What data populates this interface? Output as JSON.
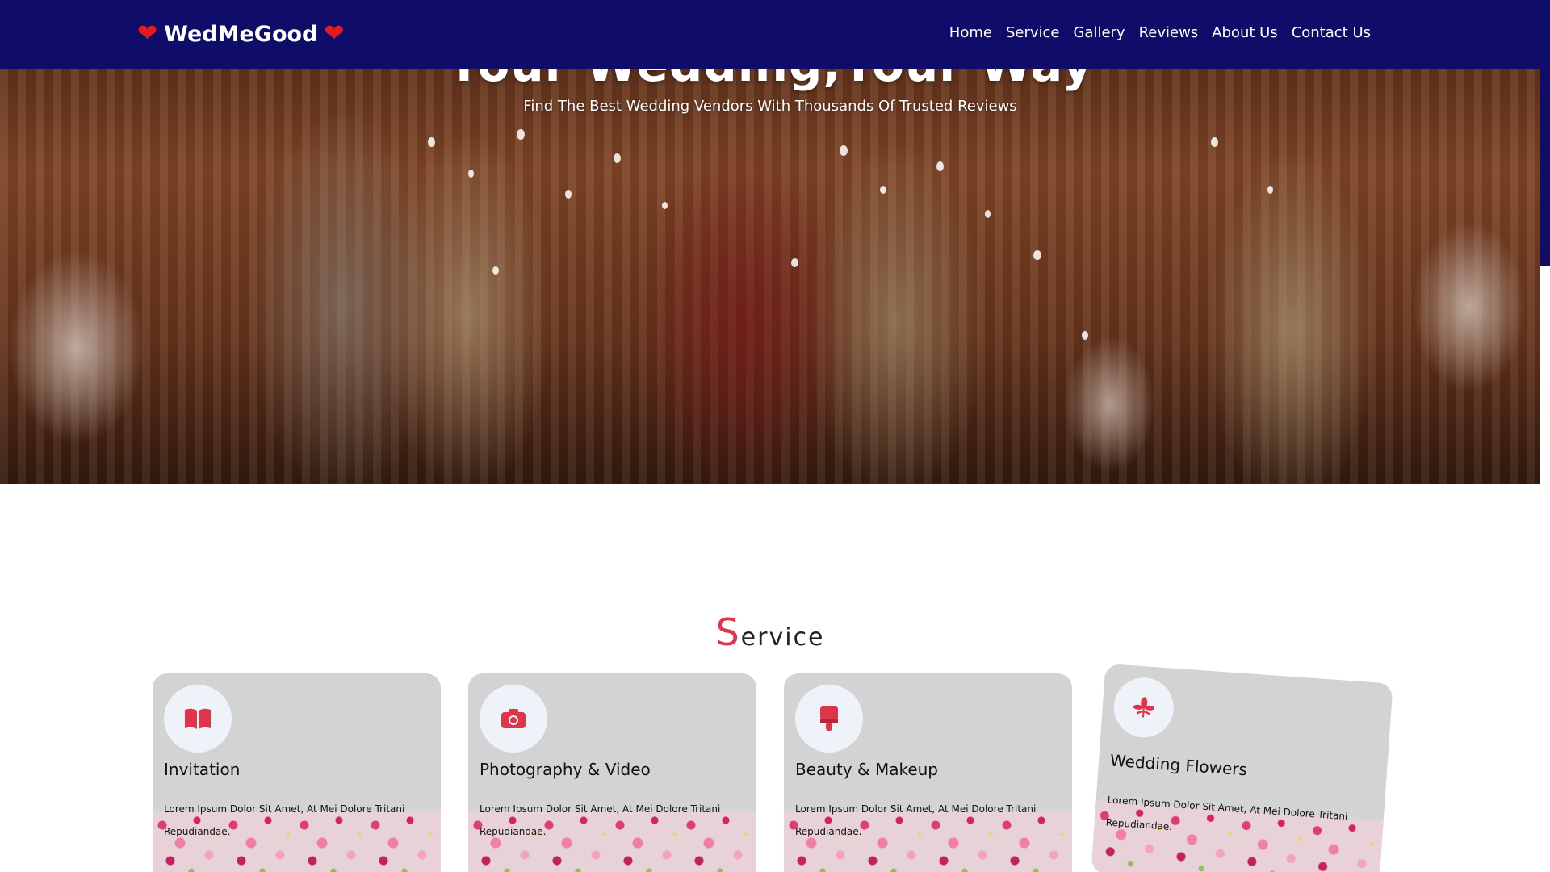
{
  "navbar": {
    "logo_text": "WedMeGood",
    "logo_heart_icon": "heart-icon",
    "links": [
      "Home",
      "Service",
      "Gallery",
      "Reviews",
      "About Us",
      "Contact Us"
    ],
    "background_color": "#100c6a"
  },
  "hero": {
    "title": "Your Wedding,Your Way",
    "subtitle": "Find The Best Wedding Vendors With Thousands Of Trusted Reviews"
  },
  "services": {
    "title_initial": "S",
    "title_rest": "ervice",
    "accent_color": "#e0344a",
    "cards": [
      {
        "icon": "book-icon",
        "title": "Invitation",
        "text": "Lorem Ipsum Dolor Sit Amet, At Mei Dolore Tritani Repudiandae."
      },
      {
        "icon": "camera-icon",
        "title": "Photography & Video",
        "text": "Lorem Ipsum Dolor Sit Amet, At Mei Dolore Tritani Repudiandae."
      },
      {
        "icon": "makeup-brush-icon",
        "title": "Beauty & Makeup",
        "text": "Lorem Ipsum Dolor Sit Amet, At Mei Dolore Tritani Repudiandae."
      },
      {
        "icon": "flower-icon",
        "title": "Wedding Flowers",
        "text": "Lorem Ipsum Dolor Sit Amet, At Mei Dolore Tritani Repudiandae."
      }
    ]
  }
}
